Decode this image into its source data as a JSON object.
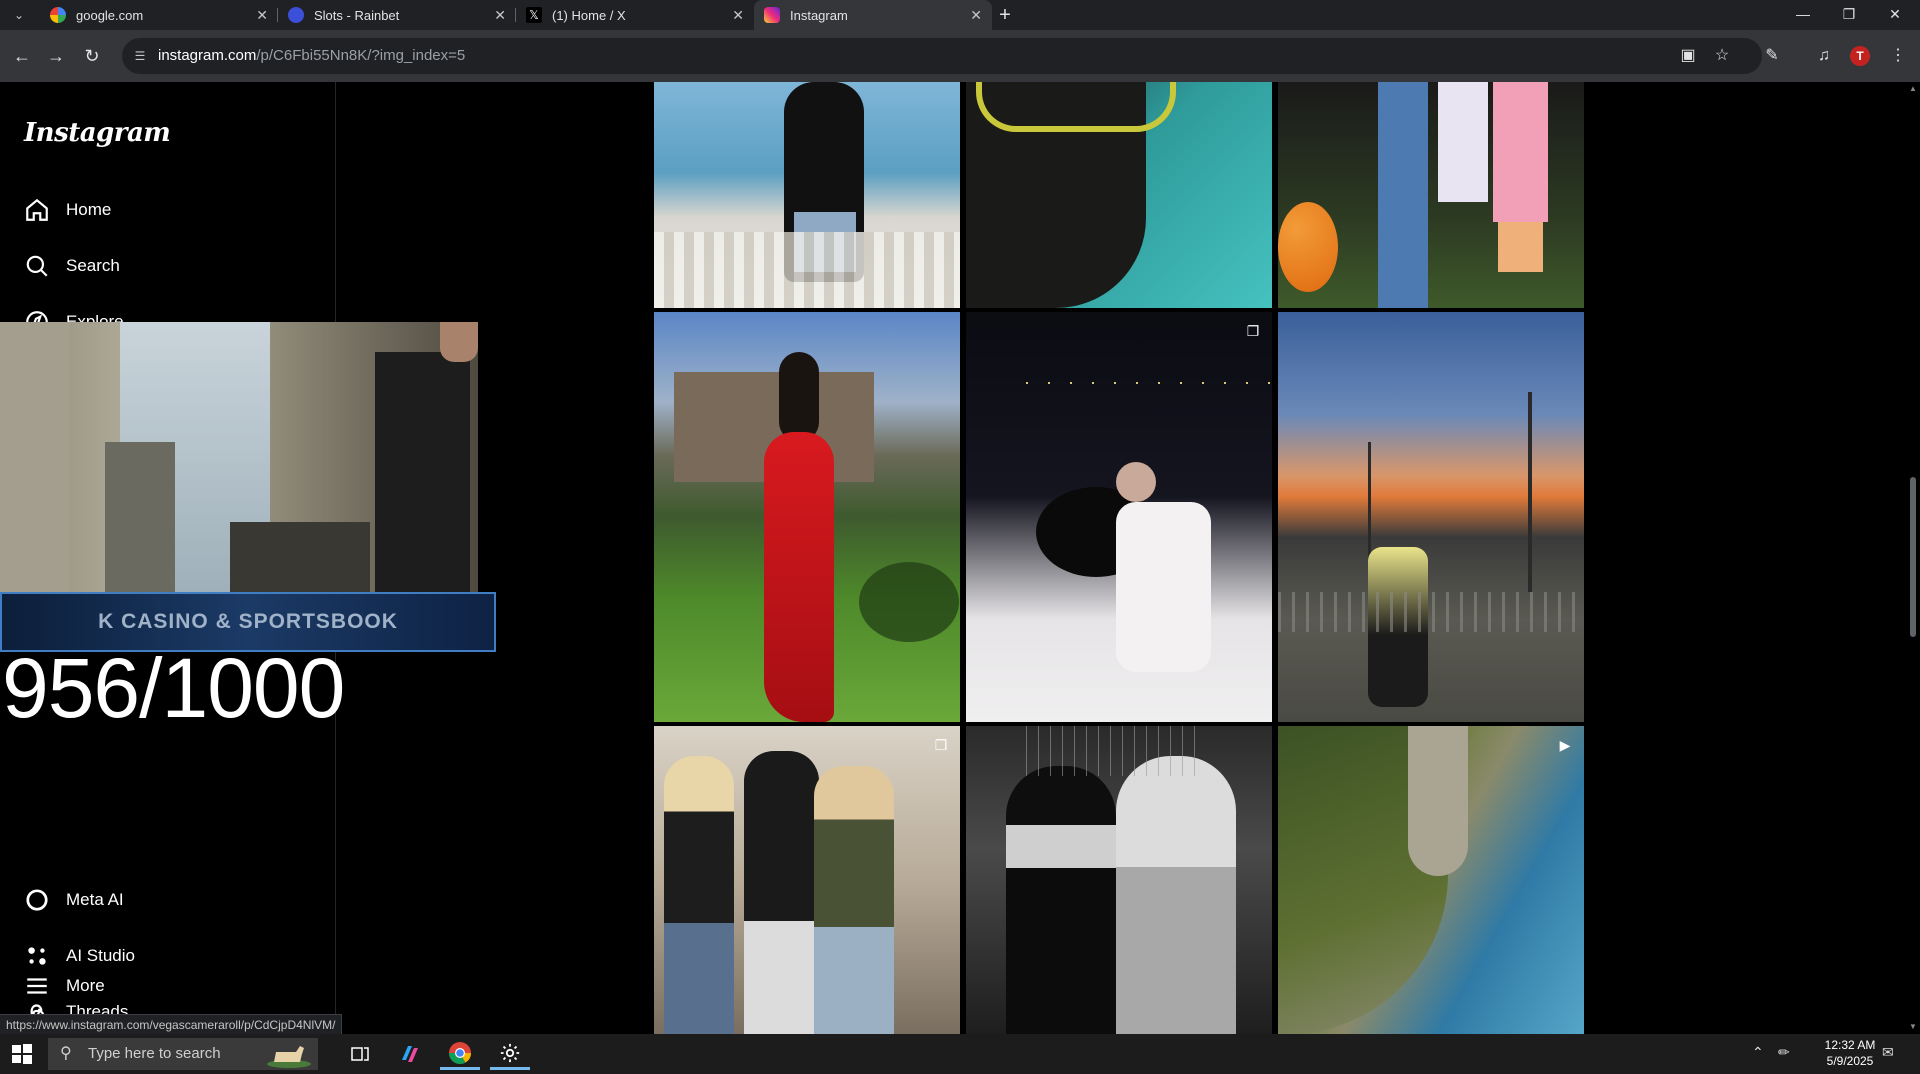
{
  "browser": {
    "tabs": [
      {
        "title": "google.com",
        "favicon": "google-icon",
        "active": false
      },
      {
        "title": "Slots - Rainbet",
        "favicon": "rainbet-icon",
        "active": false
      },
      {
        "title": "(1) Home / X",
        "favicon": "x-icon",
        "active": false
      },
      {
        "title": "Instagram",
        "favicon": "instagram-icon",
        "active": true
      }
    ],
    "url_host": "instagram.com",
    "url_path": "/p/C6Fbi55Nn8K/?img_index=5",
    "profile_initial": "T",
    "status_url": "https://www.instagram.com/vegascameraroll/p/CdCjpD4NlVM/"
  },
  "sidebar": {
    "logo": "Instagram",
    "nav": [
      {
        "label": "Home",
        "icon": "home-icon"
      },
      {
        "label": "Search",
        "icon": "search-icon"
      },
      {
        "label": "Explore",
        "icon": "compass-icon"
      },
      {
        "label": "Meta AI",
        "icon": "meta-ai-icon"
      },
      {
        "label": "AI Studio",
        "icon": "ai-studio-icon"
      },
      {
        "label": "Threads",
        "icon": "threads-icon"
      },
      {
        "label": "More",
        "icon": "menu-icon"
      }
    ]
  },
  "overlay": {
    "banner_text": "K   CASINO & SPORTSBOOK",
    "counter": "956/1000"
  },
  "grid": {
    "badges": {
      "multi_photo": "carousel-icon",
      "reel": "play-icon"
    }
  },
  "taskbar": {
    "search_placeholder": "Type here to search",
    "time": "12:32 AM",
    "date": "5/9/2025"
  }
}
